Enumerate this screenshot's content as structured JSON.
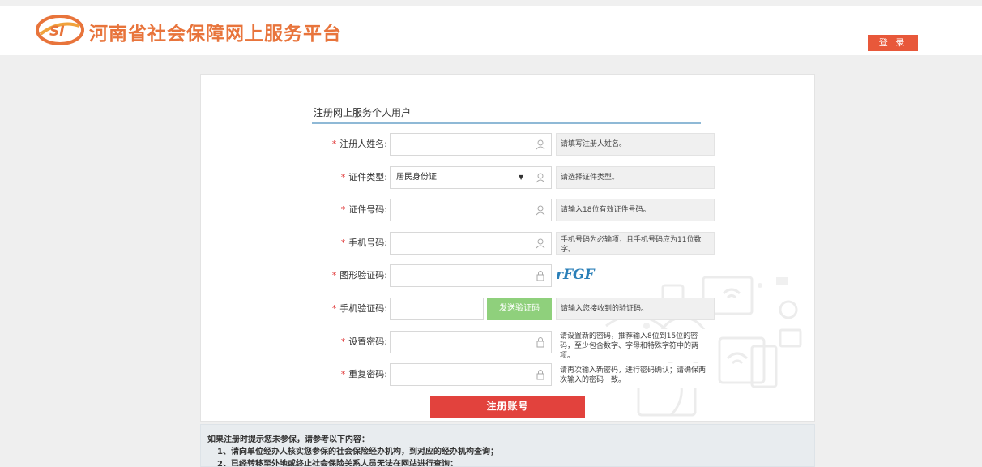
{
  "header": {
    "site_title": "河南省社会保障网上服务平台",
    "logo_text": "SI",
    "login_label": "登 录"
  },
  "form": {
    "title": "注册网上服务个人用户",
    "rows": [
      {
        "label": "注册人姓名:",
        "value": "",
        "hint": "请填写注册人姓名。"
      },
      {
        "label": "证件类型:",
        "value": "居民身份证",
        "hint": "请选择证件类型。"
      },
      {
        "label": "证件号码:",
        "value": "",
        "hint": "请输入18位有效证件号码。"
      },
      {
        "label": "手机号码:",
        "value": "",
        "hint": "手机号码为必输项，且手机号码应为11位数字。"
      },
      {
        "label": "图形验证码:",
        "value": "",
        "hint": ""
      },
      {
        "label": "手机验证码:",
        "value": "",
        "hint": "请输入您接收到的验证码。"
      },
      {
        "label": "设置密码:",
        "value": "",
        "hint": "请设置新的密码，推荐输入8位到15位的密码，至少包含数字、字母和特殊字符中的两项。"
      },
      {
        "label": "重复密码:",
        "value": "",
        "hint": "请再次输入新密码，进行密码确认；请确保两次输入的密码一致。"
      }
    ],
    "captcha_text": "rFGF",
    "sms_button": "发送验证码",
    "submit_button": "注册账号"
  },
  "notice": {
    "intro": "如果注册时提示您未参保，请参考以下内容：",
    "items": [
      "1、请向单位经办人核实您参保的社会保险经办机构，到对应的经办机构查询；",
      "2、已经转移至外地或终止社会保险关系人员无法在网站进行查询；"
    ]
  },
  "colors": {
    "brand": "#e8743b",
    "login_button": "#e8583a",
    "submit_button": "#e2423d",
    "sms_button": "#8fd07c",
    "required_star": "#e13e3e"
  }
}
